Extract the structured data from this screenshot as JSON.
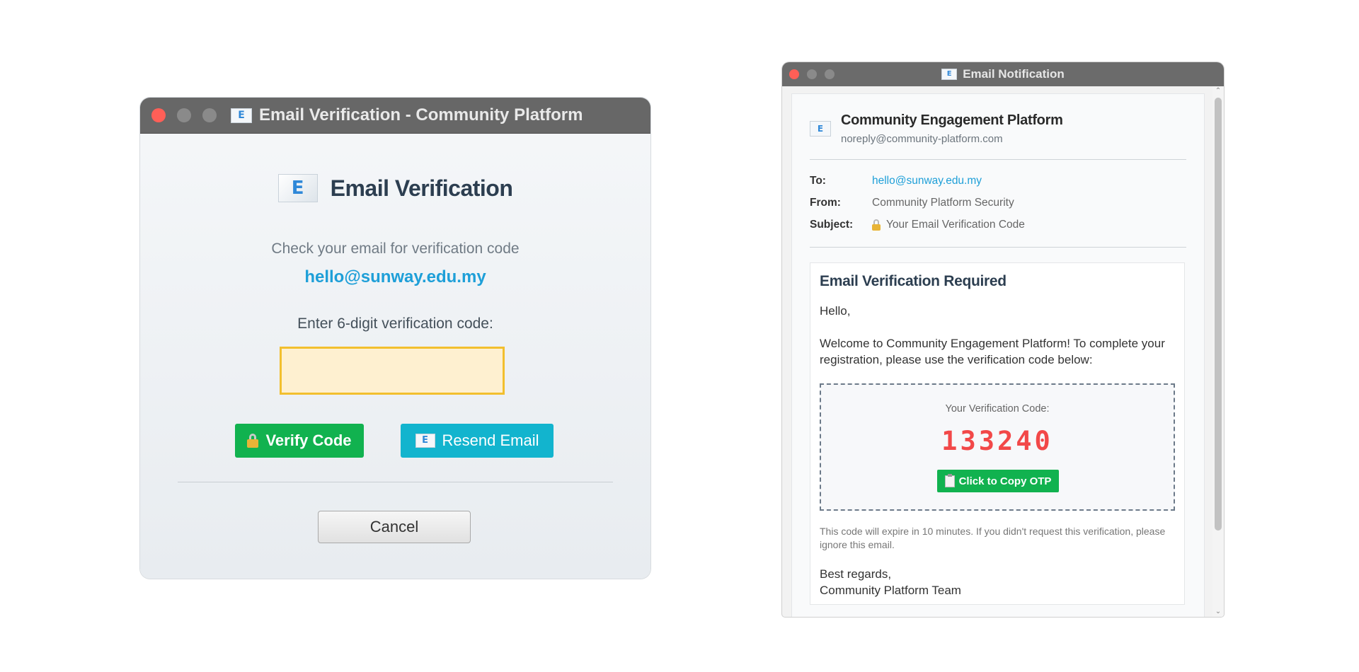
{
  "left_window": {
    "title": "Email Verification - Community Platform",
    "title_icon": "envelope-icon",
    "heading": "Email Verification",
    "subtitle": "Check your email for verification code",
    "email": "hello@sunway.edu.my",
    "prompt": "Enter 6-digit verification code:",
    "code_value": "",
    "verify_label": "Verify Code",
    "resend_label": "Resend Email",
    "cancel_label": "Cancel",
    "colors": {
      "verify": "#11b24f",
      "resend": "#12b4ce",
      "input_border": "#f2bf2e",
      "input_bg": "#fef0d0",
      "email": "#1e9fd8"
    }
  },
  "right_window": {
    "title": "Email Notification",
    "sender_name": "Community Engagement Platform",
    "sender_address": "noreply@community-platform.com",
    "meta": {
      "to_label": "To:",
      "to_value": "hello@sunway.edu.my",
      "from_label": "From:",
      "from_value": "Community Platform Security",
      "subject_label": "Subject:",
      "subject_value": "Your Email Verification Code"
    },
    "card": {
      "title": "Email Verification Required",
      "greeting": "Hello,",
      "body": "Welcome to Community Engagement Platform! To complete your registration, please use the verification code below:",
      "otp_label": "Your Verification Code:",
      "otp_code": "133240",
      "copy_label": "Click to Copy OTP",
      "expire_note": "This code will expire in 10 minutes. If you didn't request this verification, please ignore this email.",
      "regards_line1": "Best regards,",
      "regards_line2": "Community Platform Team"
    },
    "colors": {
      "otp": "#f24848",
      "copy_button": "#11b24f",
      "link": "#1e9fd8"
    }
  }
}
